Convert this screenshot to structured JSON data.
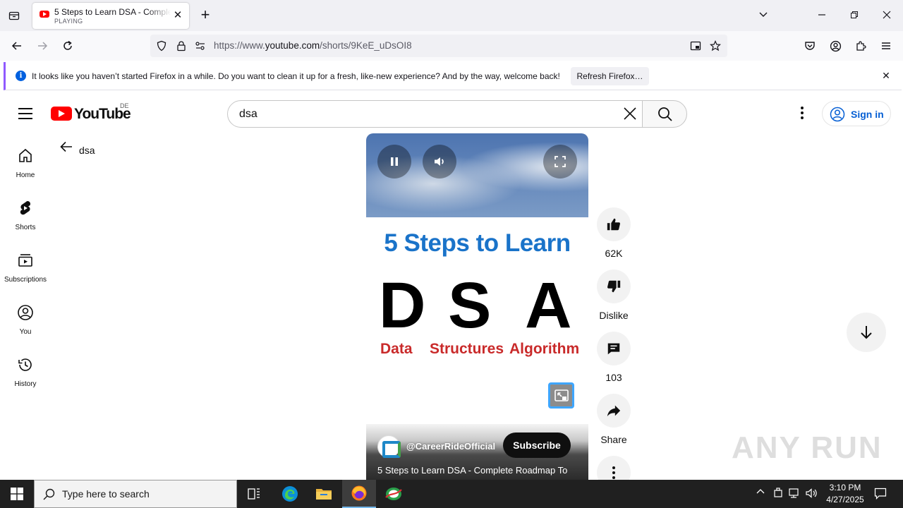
{
  "browser": {
    "tab": {
      "title": "5 Steps to Learn DSA - Complete Roadmap To",
      "status": "PLAYING"
    },
    "url": {
      "prefix": "https://www.",
      "domain": "youtube.com",
      "path": "/shorts/9KeE_uDsOI8"
    },
    "infobar": {
      "message": "It looks like you haven’t started Firefox in a while. Do you want to clean it up for a fresh, like-new experience? And by the way, welcome back!",
      "button": "Refresh Firefox…"
    }
  },
  "youtube": {
    "logo": {
      "word": "YouTube",
      "country": "DE"
    },
    "search": {
      "query": "dsa"
    },
    "signin": "Sign in",
    "sidebar": [
      {
        "label": "Home"
      },
      {
        "label": "Shorts"
      },
      {
        "label": "Subscriptions"
      },
      {
        "label": "You"
      },
      {
        "label": "History"
      }
    ],
    "back_query": "dsa",
    "video": {
      "headline": "5 Steps to Learn",
      "letters": [
        "D",
        "S",
        "A"
      ],
      "words": [
        "Data",
        "Structures",
        "Algorithm"
      ],
      "channel": "@CareerRideOfficial",
      "subscribe": "Subscribe",
      "title": "5 Steps to Learn DSA - Complete Roadmap To"
    },
    "actions": {
      "likes": "62K",
      "dislike": "Dislike",
      "comments": "103",
      "share": "Share"
    }
  },
  "watermark": "ANY RUN",
  "taskbar": {
    "search_placeholder": "Type here to search",
    "time": "3:10 PM",
    "date": "4/27/2025"
  }
}
